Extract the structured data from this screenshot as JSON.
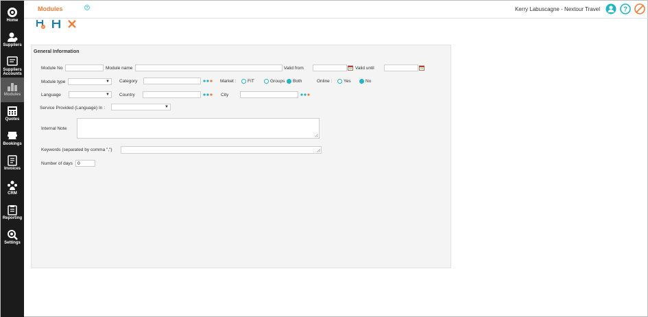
{
  "sidebar": {
    "items": [
      {
        "label": "Home",
        "icon": "home-icon"
      },
      {
        "label": "Suppliers",
        "icon": "suppliers-icon"
      },
      {
        "label": "Suppliers Accounts",
        "icon": "supplier-accounts-icon"
      },
      {
        "label": "Modules",
        "icon": "modules-icon",
        "active": true
      },
      {
        "label": "Quotes",
        "icon": "quotes-icon"
      },
      {
        "label": "Bookings",
        "icon": "bookings-icon"
      },
      {
        "label": "Invoices",
        "icon": "invoices-icon"
      },
      {
        "label": "CRM",
        "icon": "crm-icon"
      },
      {
        "label": "Reporting",
        "icon": "reporting-icon"
      },
      {
        "label": "Settings",
        "icon": "settings-icon"
      }
    ]
  },
  "header": {
    "title": "Modules",
    "user": "Kerry Labuscagne - Nextour Travel"
  },
  "colors": {
    "accent": "#f47b34",
    "teal": "#1fb5c4",
    "sidebar_bg": "#1b1b1b",
    "danger": "#f47b34"
  },
  "form": {
    "section_title": "General Information",
    "module_no": {
      "label": "Module No",
      "value": ""
    },
    "module_name": {
      "label": "Module name",
      "value": ""
    },
    "valid_from": {
      "label": "Valid from",
      "value": ""
    },
    "valid_until": {
      "label": "Valid until",
      "value": ""
    },
    "module_type": {
      "label": "Module type",
      "value": ""
    },
    "category": {
      "label": "Category",
      "value": ""
    },
    "market": {
      "label": "Market :",
      "options": [
        "FIT",
        "Groups",
        "Both"
      ],
      "selected": "Both"
    },
    "online": {
      "label": "Online :",
      "options": [
        "Yes",
        "No"
      ],
      "selected": "No"
    },
    "language": {
      "label": "Language",
      "value": ""
    },
    "country": {
      "label": "Country",
      "value": ""
    },
    "city": {
      "label": "City",
      "value": ""
    },
    "service_language": {
      "label": "Service Provided (Language) In :",
      "value": ""
    },
    "internal_note": {
      "label": "Internal Note",
      "value": ""
    },
    "keywords": {
      "label": "Keywords (separated by comma \",\")",
      "value": ""
    },
    "number_of_days": {
      "label": "Number of days",
      "value": "0"
    }
  }
}
